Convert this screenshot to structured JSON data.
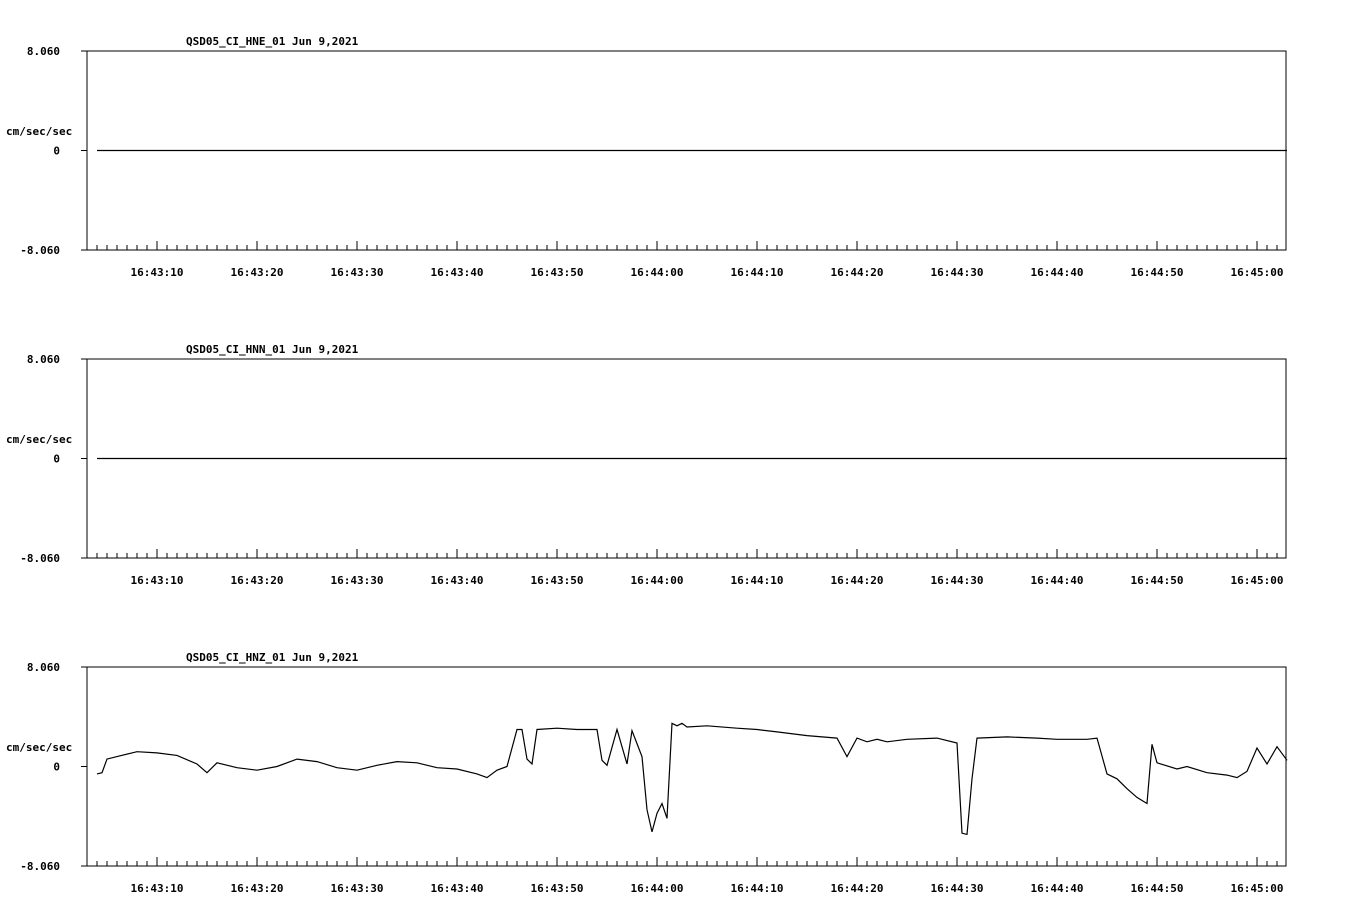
{
  "chart_data": [
    {
      "type": "line",
      "title": "QSD05_CI_HNE_01  Jun 9,2021",
      "ylabel": "cm/sec/sec",
      "ylim": [
        -8.06,
        8.06
      ],
      "y_ticks": [
        "8.060",
        "0",
        "-8.060"
      ],
      "x_tick_labels": [
        "16:43:10",
        "16:43:20",
        "16:43:30",
        "16:43:40",
        "16:43:50",
        "16:44:00",
        "16:44:10",
        "16:44:20",
        "16:44:30",
        "16:44:40",
        "16:44:50",
        "16:45:00"
      ],
      "grid": false,
      "series": [
        {
          "x": [
            "16:43:04",
            "16:45:03"
          ],
          "values": [
            0,
            0
          ]
        }
      ]
    },
    {
      "type": "line",
      "title": "QSD05_CI_HNN_01  Jun 9,2021",
      "ylabel": "cm/sec/sec",
      "ylim": [
        -8.06,
        8.06
      ],
      "y_ticks": [
        "8.060",
        "0",
        "-8.060"
      ],
      "x_tick_labels": [
        "16:43:10",
        "16:43:20",
        "16:43:30",
        "16:43:40",
        "16:43:50",
        "16:44:00",
        "16:44:10",
        "16:44:20",
        "16:44:30",
        "16:44:40",
        "16:44:50",
        "16:45:00"
      ],
      "grid": false,
      "series": [
        {
          "x": [
            "16:43:04",
            "16:45:03"
          ],
          "values": [
            0,
            0
          ]
        }
      ]
    },
    {
      "type": "line",
      "title": "QSD05_CI_HNZ_01  Jun 9,2021",
      "ylabel": "cm/sec/sec",
      "ylim": [
        -8.06,
        8.06
      ],
      "y_ticks": [
        "8.060",
        "0",
        "-8.060"
      ],
      "x_tick_labels": [
        "16:43:10",
        "16:43:20",
        "16:43:30",
        "16:43:40",
        "16:43:50",
        "16:44:00",
        "16:44:10",
        "16:44:20",
        "16:44:30",
        "16:44:40",
        "16:44:50",
        "16:45:00"
      ],
      "grid": false,
      "series": [
        {
          "x": [
            "16:43:04",
            "16:43:04.5",
            "16:43:05",
            "16:43:06",
            "16:43:08",
            "16:43:10",
            "16:43:12",
            "16:43:14",
            "16:43:15",
            "16:43:16",
            "16:43:18",
            "16:43:20",
            "16:43:22",
            "16:43:24",
            "16:43:26",
            "16:43:28",
            "16:43:30",
            "16:43:32",
            "16:43:34",
            "16:43:36",
            "16:43:38",
            "16:43:40",
            "16:43:42",
            "16:43:43",
            "16:43:44",
            "16:43:45",
            "16:43:46",
            "16:43:46.5",
            "16:43:47",
            "16:43:47.5",
            "16:43:48",
            "16:43:50",
            "16:43:52",
            "16:43:54",
            "16:43:54.5",
            "16:43:55",
            "16:43:56",
            "16:43:57",
            "16:43:57.5",
            "16:43:58.5",
            "16:43:59",
            "16:43:59.5",
            "16:44:00",
            "16:44:00.5",
            "16:44:01",
            "16:44:01.5",
            "16:44:02",
            "16:44:02.5",
            "16:44:03",
            "16:44:05",
            "16:44:08",
            "16:44:10",
            "16:44:12",
            "16:44:15",
            "16:44:18",
            "16:44:19",
            "16:44:20",
            "16:44:21",
            "16:44:22",
            "16:44:23",
            "16:44:25",
            "16:44:28",
            "16:44:30",
            "16:44:30.5",
            "16:44:31",
            "16:44:31.5",
            "16:44:32",
            "16:44:35",
            "16:44:38",
            "16:44:40",
            "16:44:43",
            "16:44:44",
            "16:44:45",
            "16:44:46",
            "16:44:47",
            "16:44:48",
            "16:44:49",
            "16:44:49.5",
            "16:44:50",
            "16:44:52",
            "16:44:53",
            "16:44:55",
            "16:44:57",
            "16:44:58",
            "16:44:59",
            "16:45:00",
            "16:45:01",
            "16:45:02",
            "16:45:03"
          ],
          "values": [
            -0.6,
            -0.5,
            0.6,
            0.8,
            1.2,
            1.1,
            0.9,
            0.2,
            -0.5,
            0.3,
            -0.1,
            -0.3,
            0.0,
            0.6,
            0.4,
            -0.1,
            -0.3,
            0.1,
            0.4,
            0.3,
            -0.1,
            -0.2,
            -0.6,
            -0.9,
            -0.3,
            0.0,
            3.0,
            3.0,
            0.6,
            0.2,
            3.0,
            3.1,
            3.0,
            3.0,
            0.5,
            0.1,
            3.0,
            0.2,
            2.9,
            0.8,
            -3.5,
            -5.3,
            -3.8,
            -3.0,
            -4.2,
            3.5,
            3.3,
            3.5,
            3.2,
            3.3,
            3.1,
            3.0,
            2.8,
            2.5,
            2.3,
            0.8,
            2.3,
            2.0,
            2.2,
            2.0,
            2.2,
            2.3,
            1.9,
            -5.4,
            -5.5,
            -1.0,
            2.3,
            2.4,
            2.3,
            2.2,
            2.2,
            2.3,
            -0.6,
            -1.0,
            -1.8,
            -2.5,
            -3.0,
            1.8,
            0.3,
            -0.2,
            0.0,
            -0.5,
            -0.7,
            -0.9,
            -0.4,
            1.5,
            0.2,
            1.6,
            0.5
          ]
        }
      ]
    }
  ]
}
